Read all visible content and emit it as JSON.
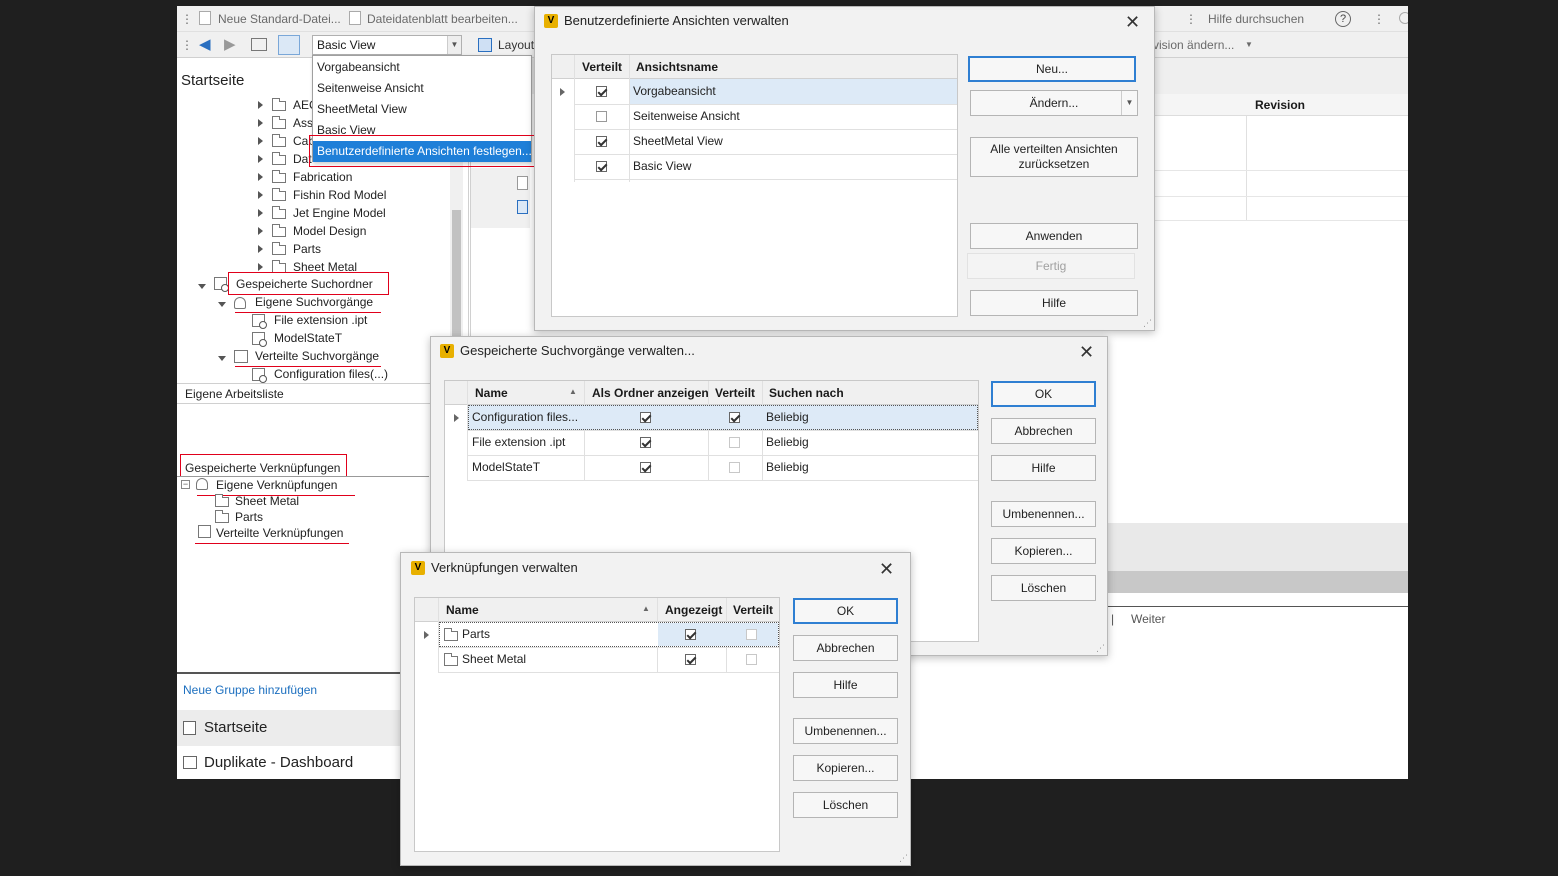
{
  "toolbar": {
    "new_std_file": "Neue Standard-Datei...",
    "edit_datasheet": "Dateidatenblatt bearbeiten...",
    "search_help_placeholder": "Hilfe durchsuchen",
    "view_combo_value": "Basic View",
    "layout_label": "Layout",
    "revision_change": "vision ändern..."
  },
  "view_menu": {
    "items": [
      "Vorgabeansicht",
      "Seitenweise Ansicht",
      "SheetMetal View",
      "Basic View",
      "Benutzerdefinierte Ansichten festlegen..."
    ]
  },
  "nav": {
    "title": "Startseite",
    "folders": [
      "AEC",
      "Ass",
      "Cab",
      "Dat",
      "Fabrication",
      "Fishin Rod Model",
      "Jet Engine Model",
      "Model Design",
      "Parts",
      "Sheet Metal"
    ],
    "saved_search_folder": "Gespeicherte Suchordner",
    "own_searches": "Eigene Suchvorgänge",
    "own_search_items": [
      "File extension .ipt",
      "ModelStateT"
    ],
    "shared_searches": "Verteilte Suchvorgänge",
    "shared_search_items": [
      "Configuration files(...)"
    ],
    "worklist": "Eigene Arbeitsliste",
    "saved_links": "Gespeicherte Verknüpfungen",
    "own_links": "Eigene Verknüpfungen",
    "own_link_items": [
      "Sheet Metal",
      "Parts"
    ],
    "shared_links": "Verteilte Verknüpfungen",
    "add_group": "Neue Gruppe hinzufügen",
    "bottom_tabs": [
      "Startseite",
      "Duplikate - Dashboard"
    ]
  },
  "main": {
    "revision_header": "Revision",
    "pager_next": "Weiter"
  },
  "dialog_views": {
    "title": "Benutzerdefinierte Ansichten verwalten",
    "columns": [
      "Verteilt",
      "Ansichtsname"
    ],
    "rows": [
      {
        "name": "Vorgabeansicht",
        "shared": true
      },
      {
        "name": "Seitenweise Ansicht",
        "shared": false
      },
      {
        "name": "SheetMetal View",
        "shared": true
      },
      {
        "name": "Basic View",
        "shared": true
      }
    ],
    "buttons": {
      "new": "Neu...",
      "change": "Ändern...",
      "reset": "Alle verteilten Ansichten zurücksetzen",
      "apply": "Anwenden",
      "done": "Fertig",
      "help": "Hilfe"
    }
  },
  "dialog_searches": {
    "title": "Gespeicherte Suchvorgänge verwalten...",
    "columns": [
      "Name",
      "Als Ordner anzeigen",
      "Verteilt",
      "Suchen nach"
    ],
    "rows": [
      {
        "name": "Configuration files...",
        "as_folder": true,
        "shared": true,
        "search_for": "Beliebig"
      },
      {
        "name": "File extension .ipt",
        "as_folder": true,
        "shared": false,
        "search_for": "Beliebig"
      },
      {
        "name": "ModelStateT",
        "as_folder": true,
        "shared": false,
        "search_for": "Beliebig"
      }
    ],
    "buttons": {
      "ok": "OK",
      "cancel": "Abbrechen",
      "help": "Hilfe",
      "rename": "Umbenennen...",
      "copy": "Kopieren...",
      "delete": "Löschen"
    }
  },
  "dialog_links": {
    "title": "Verknüpfungen verwalten",
    "columns": [
      "Name",
      "Angezeigt",
      "Verteilt"
    ],
    "rows": [
      {
        "name": "Parts",
        "shown": true,
        "shared": false
      },
      {
        "name": "Sheet Metal",
        "shown": true,
        "shared": false
      }
    ],
    "buttons": {
      "ok": "OK",
      "cancel": "Abbrechen",
      "help": "Hilfe",
      "rename": "Umbenennen...",
      "copy": "Kopieren...",
      "delete": "Löschen"
    }
  },
  "colors": {
    "accent": "#1e7fd8",
    "highlight_red": "#e0001b",
    "link": "#1c6fbf",
    "vault_logo": "#e8b000"
  }
}
